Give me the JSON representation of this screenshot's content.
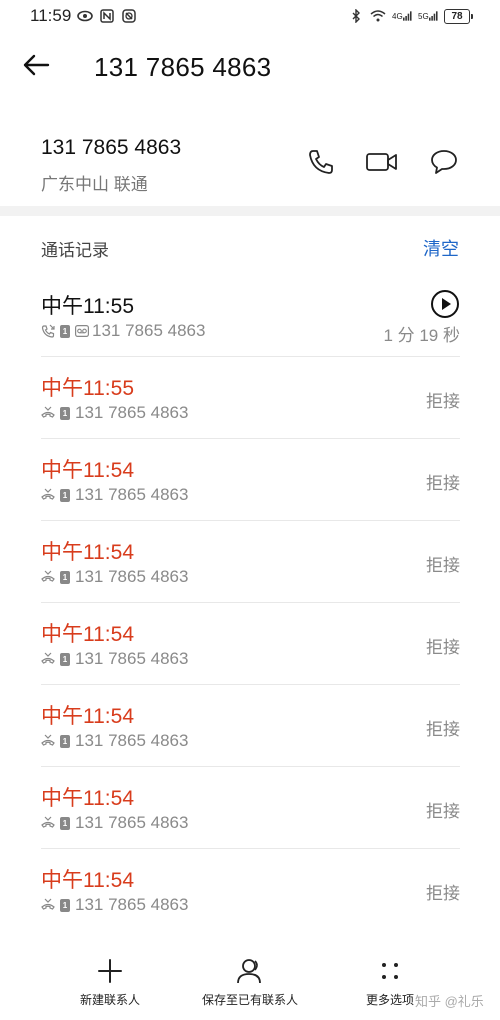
{
  "status_bar": {
    "time": "11:59",
    "battery": "78",
    "signal_label_1": "4G",
    "signal_label_2": "5G"
  },
  "header": {
    "title": "131 7865 4863"
  },
  "contact": {
    "number": "131 7865 4863",
    "location": "广东中山 联通"
  },
  "section": {
    "title": "通话记录",
    "clear_label": "清空"
  },
  "calls": [
    {
      "time": "中午11:55",
      "number": "131 7865 4863",
      "status": "1 分 19 秒",
      "missed": false
    },
    {
      "time": "中午11:55",
      "number": "131 7865 4863",
      "status": "拒接",
      "missed": true
    },
    {
      "time": "中午11:54",
      "number": "131 7865 4863",
      "status": "拒接",
      "missed": true
    },
    {
      "time": "中午11:54",
      "number": "131 7865 4863",
      "status": "拒接",
      "missed": true
    },
    {
      "time": "中午11:54",
      "number": "131 7865 4863",
      "status": "拒接",
      "missed": true
    },
    {
      "time": "中午11:54",
      "number": "131 7865 4863",
      "status": "拒接",
      "missed": true
    },
    {
      "time": "中午11:54",
      "number": "131 7865 4863",
      "status": "拒接",
      "missed": true
    },
    {
      "time": "中午11:54",
      "number": "131 7865 4863",
      "status": "拒接",
      "missed": true
    }
  ],
  "bottom_bar": {
    "new_contact": "新建联系人",
    "save_existing": "保存至已有联系人",
    "more": "更多选项"
  },
  "watermark": "知乎 @礼乐",
  "colors": {
    "accent": "#1e66c8",
    "missed": "#d83c1c"
  },
  "icons": {
    "back": "back-arrow-icon",
    "call": "phone-icon",
    "video": "video-camera-icon",
    "message": "message-bubble-icon",
    "play": "play-icon",
    "add": "plus-icon",
    "person": "person-icon",
    "more": "more-dots-icon"
  }
}
